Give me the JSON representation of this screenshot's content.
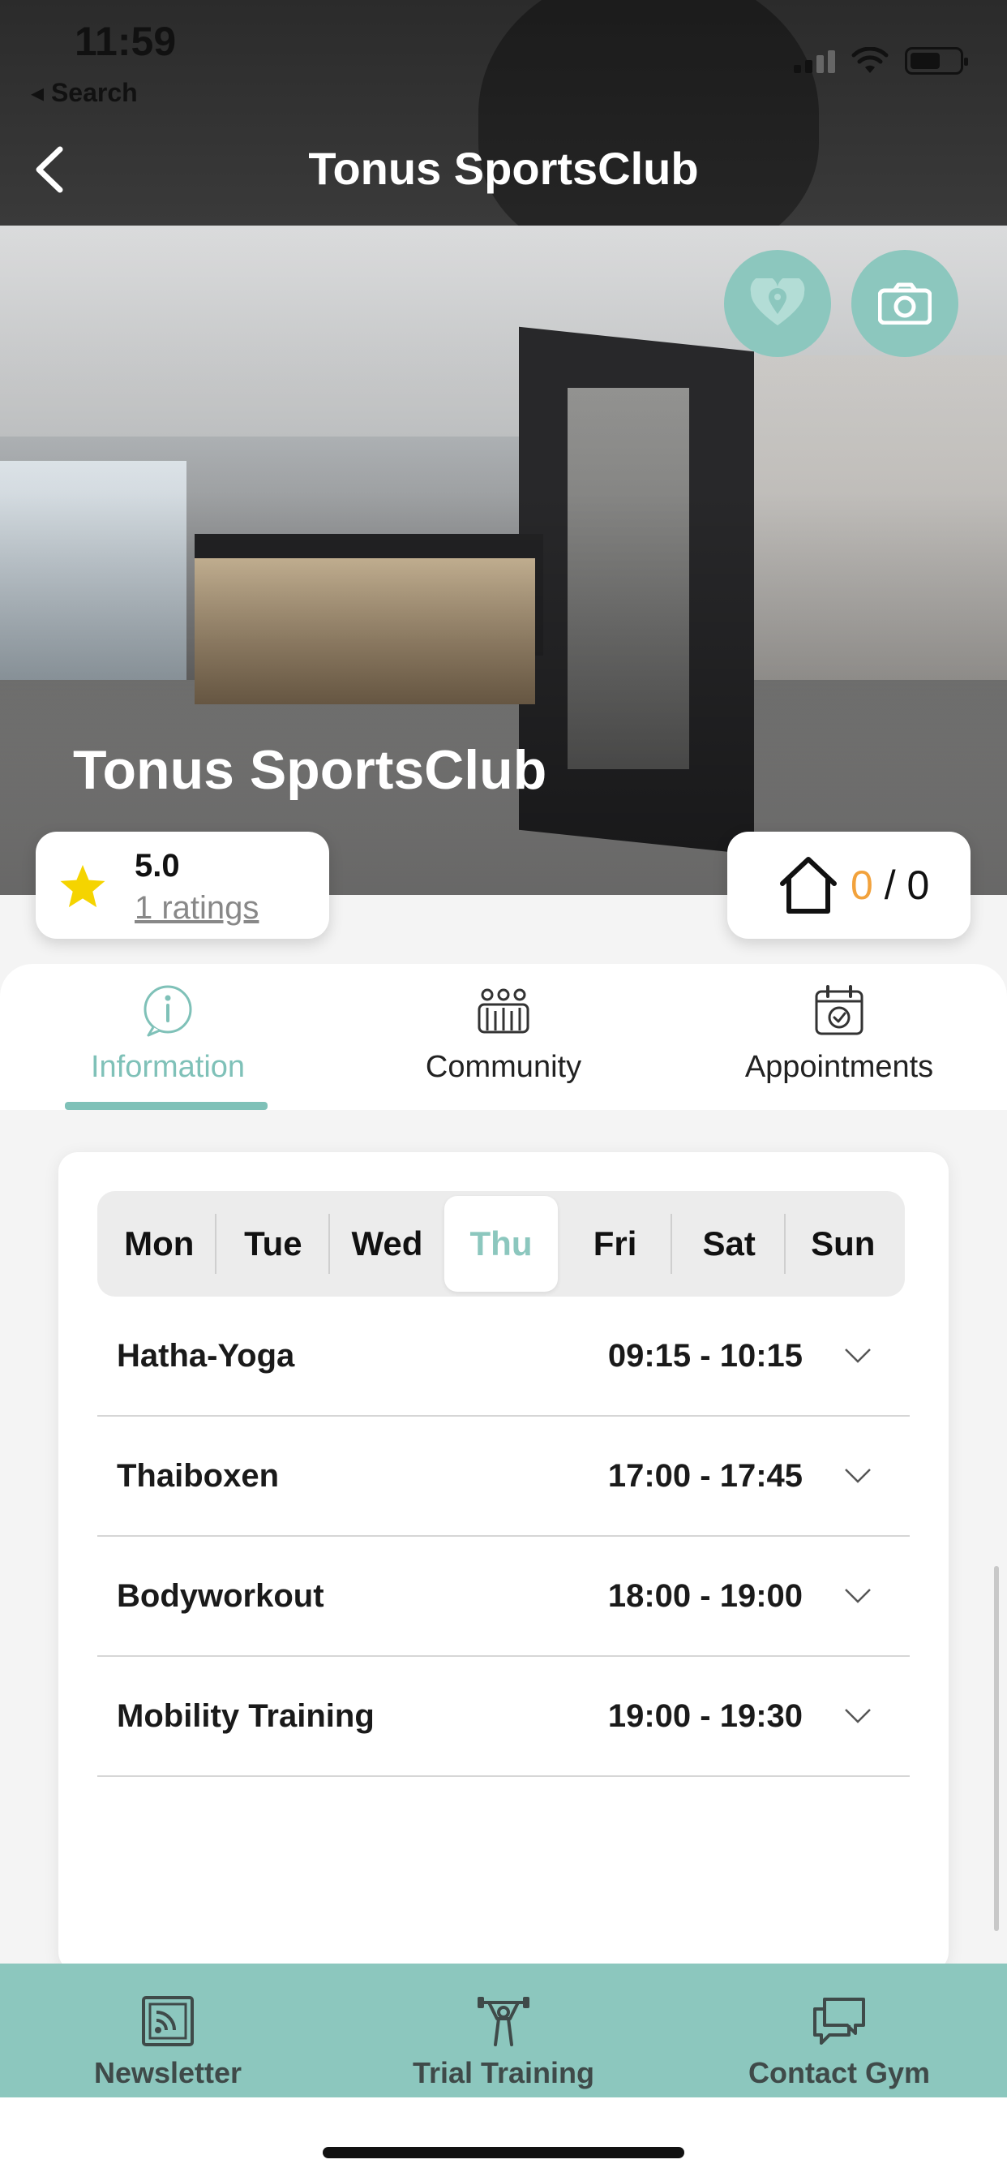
{
  "status_bar": {
    "time": "11:59",
    "back_label": "◂ Search"
  },
  "nav": {
    "title": "Tonus SportsClub"
  },
  "hero": {
    "title": "Tonus SportsClub"
  },
  "rating": {
    "value": "5.0",
    "count_label": "1 ratings"
  },
  "capacity": {
    "current": "0",
    "separator": " / ",
    "total": "0"
  },
  "tabs": [
    {
      "label": "Information",
      "icon": "info-icon",
      "active": true
    },
    {
      "label": "Community",
      "icon": "community-icon",
      "active": false
    },
    {
      "label": "Appointments",
      "icon": "calendar-icon",
      "active": false
    }
  ],
  "days": [
    "Mon",
    "Tue",
    "Wed",
    "Thu",
    "Fri",
    "Sat",
    "Sun"
  ],
  "selected_day": "Thu",
  "classes": [
    {
      "name": "Hatha-Yoga",
      "time": "09:15 - 10:15"
    },
    {
      "name": "Thaiboxen",
      "time": "17:00 - 17:45"
    },
    {
      "name": "Bodyworkout",
      "time": "18:00 - 19:00"
    },
    {
      "name": "Mobility Training",
      "time": "19:00 - 19:30"
    }
  ],
  "actions": [
    {
      "label": "Newsletter",
      "icon": "newsletter-icon"
    },
    {
      "label": "Trial Training",
      "icon": "weightlifter-icon"
    },
    {
      "label": "Contact Gym",
      "icon": "chat-icon"
    }
  ],
  "colors": {
    "accent": "#8cc7be",
    "tab_active": "#7fc1b8",
    "capacity_current": "#f2a23c",
    "star": "#f5d400"
  }
}
